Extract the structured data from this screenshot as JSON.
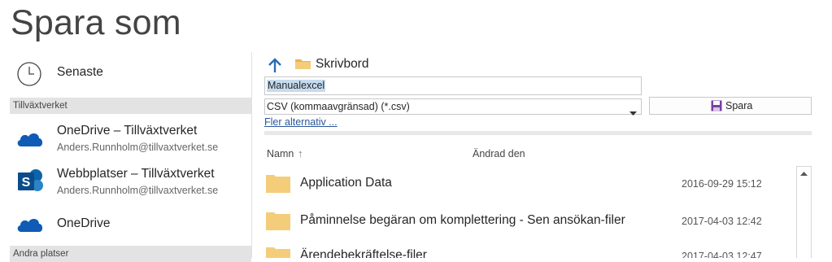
{
  "title": "Spara som",
  "nav": {
    "recent_label": "Senaste",
    "group1_header": "Tillväxtverket",
    "onedrive_org_label": "OneDrive – Tillväxtverket",
    "onedrive_org_account": "Anders.Runnholm@tillvaxtverket.se",
    "sharepoint_label": "Webbplatser – Tillväxtverket",
    "sharepoint_account": "Anders.Runnholm@tillvaxtverket.se",
    "onedrive_label": "OneDrive",
    "group2_header": "Andra platser"
  },
  "location": {
    "breadcrumb": "Skrivbord"
  },
  "form": {
    "filename_value": "Manualexcel",
    "filetype_value": "CSV (kommaavgränsad) (*.csv)",
    "save_label": "Spara",
    "more_options": "Fler alternativ ..."
  },
  "file_list": {
    "col_name": "Namn",
    "col_modified": "Ändrad den",
    "rows": [
      {
        "name": "Application Data",
        "modified": "2016-09-29 15:12"
      },
      {
        "name": "Påminnelse begäran om komplettering - Sen ansökan-filer",
        "modified": "2017-04-03 12:42"
      },
      {
        "name": "Ärendebekräftelse-filer",
        "modified": "2017-04-03 12:47"
      }
    ]
  },
  "colors": {
    "onedrive_blue": "#0f5bb5",
    "sharepoint_blue": "#0e64a8",
    "folder_yellow": "#f3cd79",
    "link_blue": "#2b579a",
    "selection": "#c6dbef"
  },
  "icons": {
    "recent": "clock-icon",
    "onedrive": "cloud-icon",
    "sharepoint": "sharepoint-icon",
    "up": "arrow-up-icon",
    "folder": "folder-icon",
    "save": "floppy-disk-icon"
  }
}
